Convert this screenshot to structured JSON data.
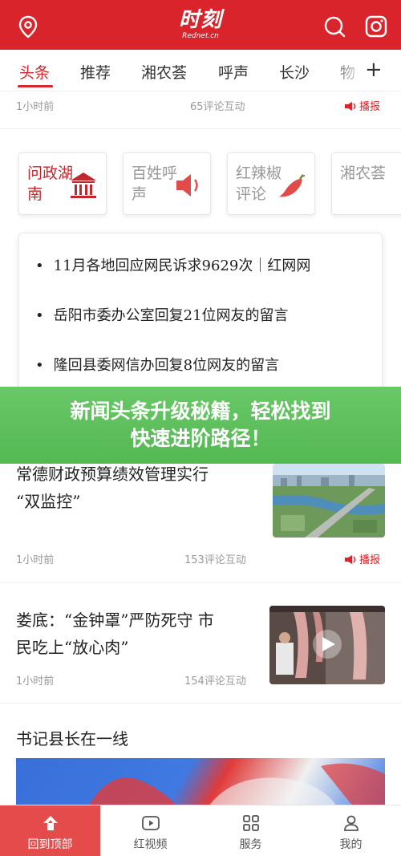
{
  "header": {
    "logo_main": "时刻",
    "logo_sub": "Rednet.cn",
    "icons": [
      "location-icon",
      "search-icon",
      "camera-icon"
    ]
  },
  "tabs": {
    "items": [
      {
        "label": "头条",
        "active": true
      },
      {
        "label": "推荐"
      },
      {
        "label": "湘农荟"
      },
      {
        "label": "呼声"
      },
      {
        "label": "长沙"
      },
      {
        "label": "物"
      }
    ],
    "add_label": "+"
  },
  "top_item": {
    "time": "1小时前",
    "comments": "65评论互动",
    "broadcast": "播报"
  },
  "categories": [
    {
      "label": "问政湖南",
      "icon": "government-building-icon"
    },
    {
      "label": "百姓呼声",
      "icon": "megaphone-icon"
    },
    {
      "label": "红辣椒评论",
      "icon": "chili-pepper-icon"
    },
    {
      "label": "湘农荟",
      "icon": ""
    }
  ],
  "dropdown": {
    "items": [
      "11月各地回应网民诉求9629次｜红网网",
      "岳阳市委办公室回复21位网友的留言",
      "隆回县委网信办回复8位网友的留言"
    ]
  },
  "overlay_banner": {
    "line1": "新闻头条升级秘籍，轻松找到",
    "line2": "快速进阶路径！"
  },
  "news": [
    {
      "title_line1": "常德财政预算绩效管理实行",
      "title_line2": "“双监控”",
      "time": "1小时前",
      "comments": "153评论互动",
      "broadcast": "播报"
    },
    {
      "title_line1": "娄底：“金钟罩”严防死守 市",
      "title_line2": "民吃上“放心肉”",
      "time": "1小时前",
      "comments": "154评论互动"
    }
  ],
  "section": {
    "title": "书记县长在一线"
  },
  "bottom_nav": [
    {
      "label": "回到顶部",
      "icon": "back-to-top-icon",
      "active": true
    },
    {
      "label": "红视频",
      "icon": "video-icon"
    },
    {
      "label": "服务",
      "icon": "grid-icon"
    },
    {
      "label": "我的",
      "icon": "user-icon"
    }
  ],
  "colors": {
    "brand_red": "#d9242b",
    "banner_green": "#5cc05b"
  }
}
